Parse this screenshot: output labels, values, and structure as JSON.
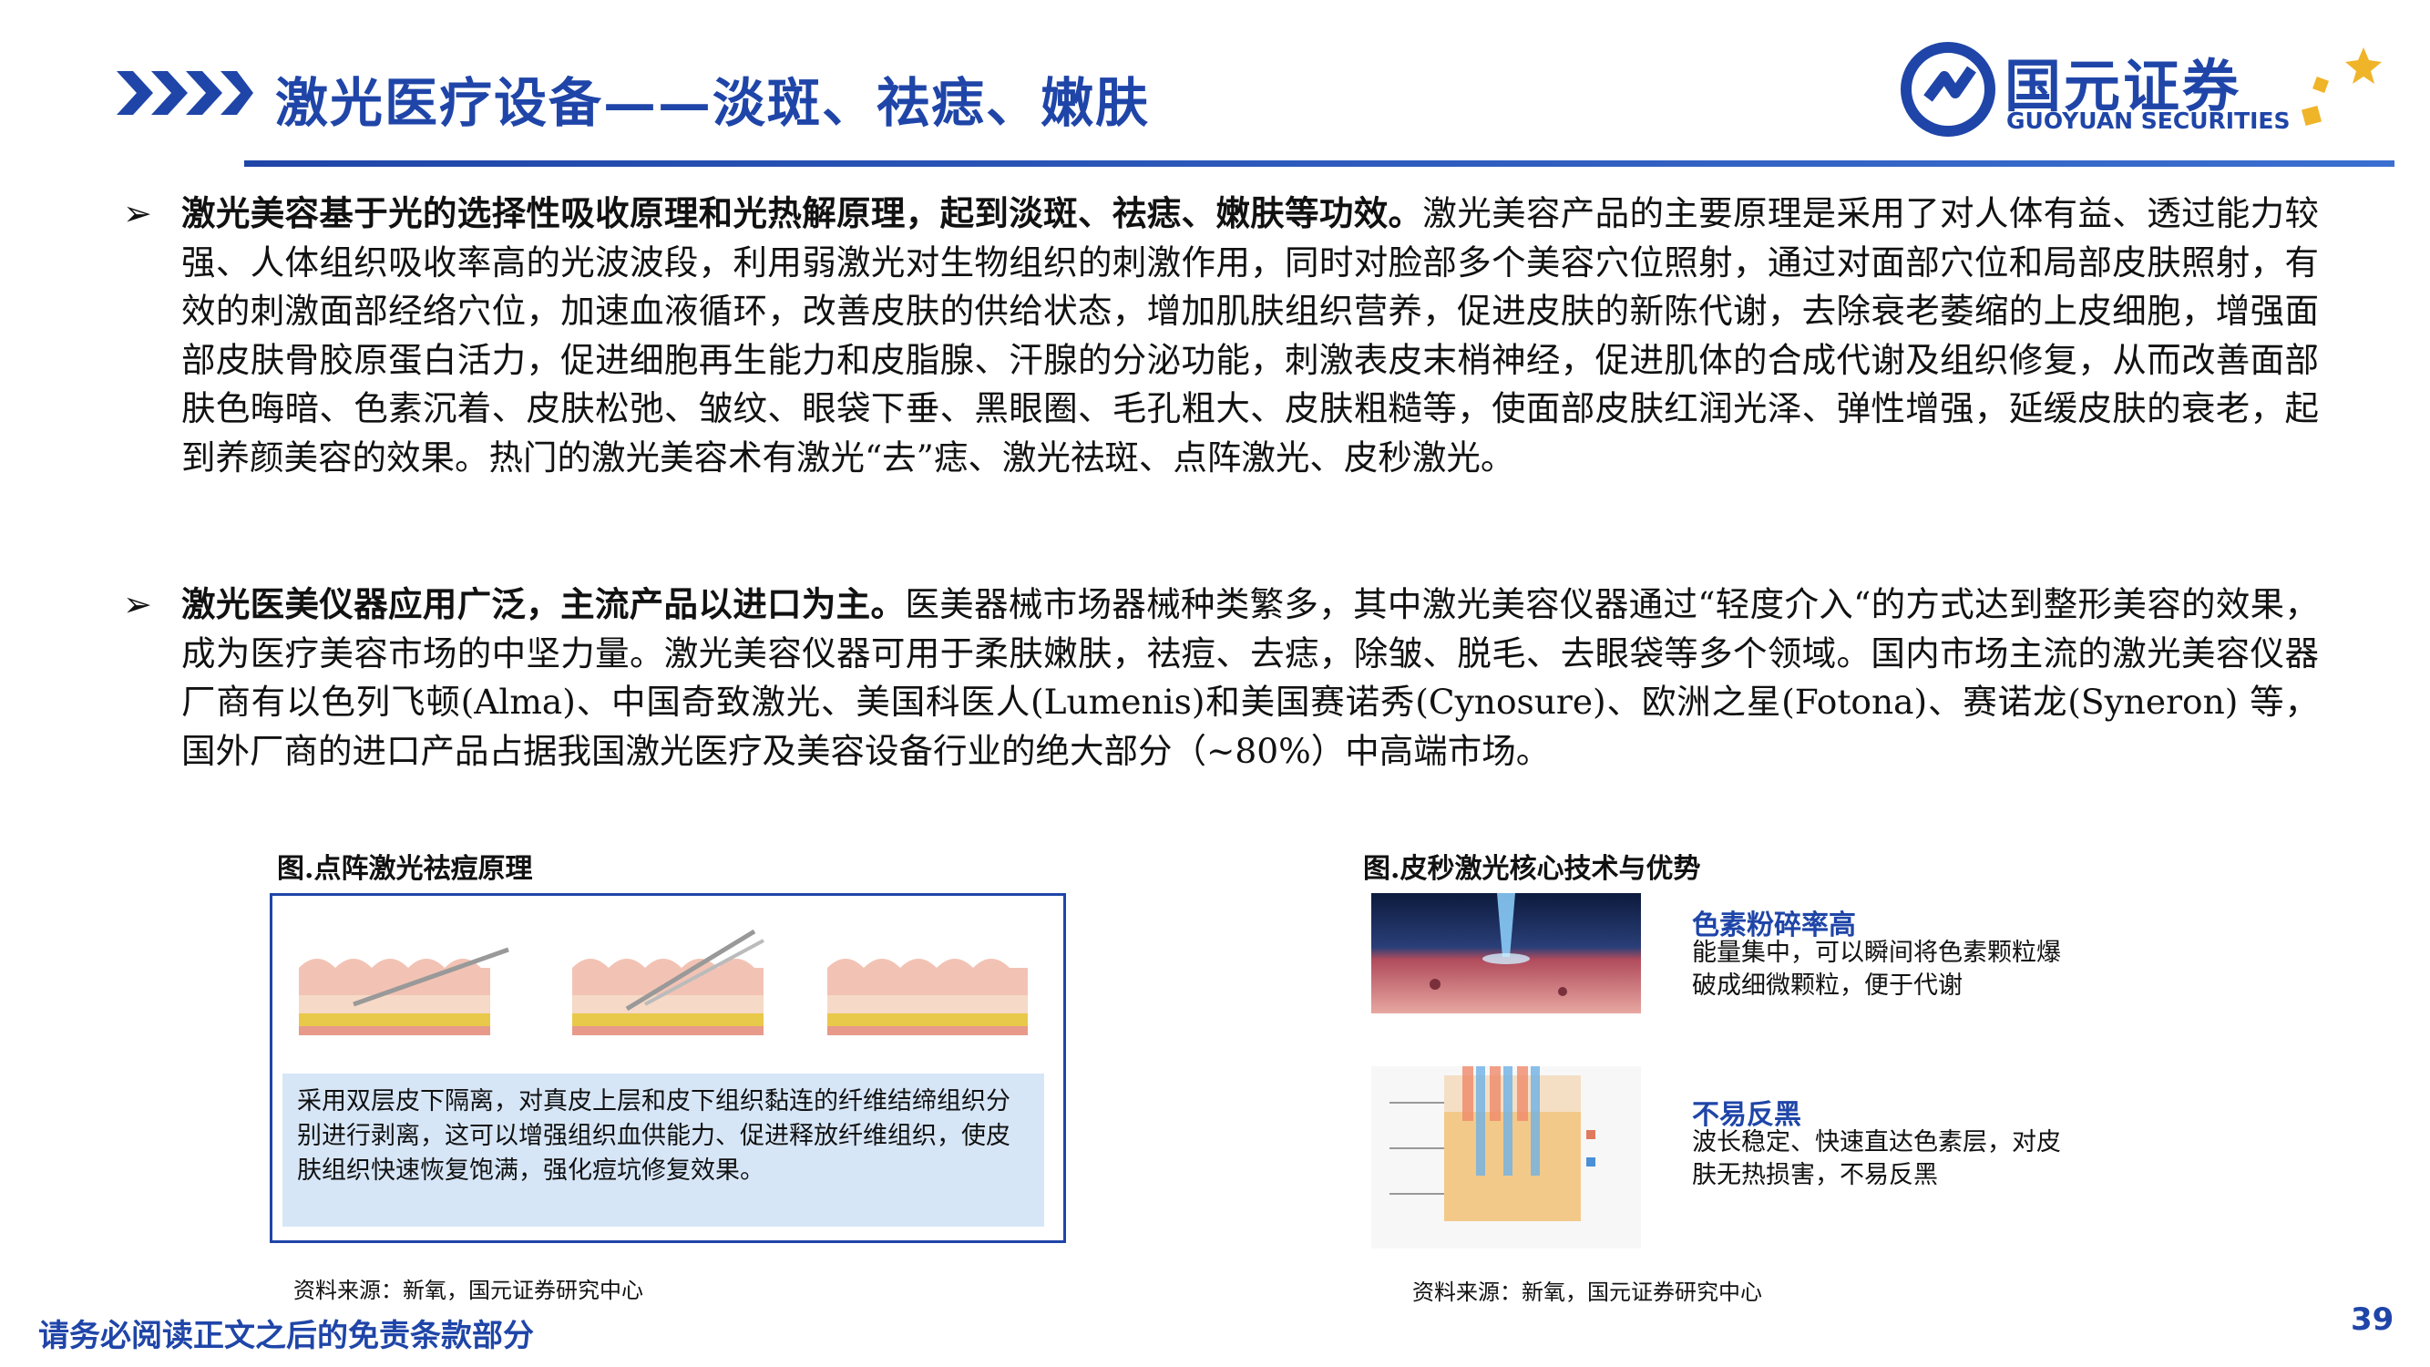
{
  "header": {
    "title": "激光医疗设备——淡斑、祛痣、嫩肤",
    "logo_cn": "国元证券",
    "logo_en": "GUOYUAN SECURITIES"
  },
  "bullets": [
    {
      "marker": "➢",
      "bold": "激光美容基于光的选择性吸收原理和光热解原理，起到淡斑、祛痣、嫩肤等功效。",
      "text": "激光美容产品的主要原理是采用了对人体有益、透过能力较强、人体组织吸收率高的光波波段，利用弱激光对生物组织的刺激作用，同时对脸部多个美容穴位照射，通过对面部穴位和局部皮肤照射，有效的刺激面部经络穴位，加速血液循环，改善皮肤的供给状态，增加肌肤组织营养，促进皮肤的新陈代谢，去除衰老萎缩的上皮细胞，增强面部皮肤骨胶原蛋白活力，促进细胞再生能力和皮脂腺、汗腺的分泌功能，刺激表皮末梢神经，促进肌体的合成代谢及组织修复，从而改善面部肤色晦暗、色素沉着、皮肤松弛、皱纹、眼袋下垂、黑眼圈、毛孔粗大、皮肤粗糙等，使面部皮肤红润光泽、弹性增强，延缓皮肤的衰老，起到养颜美容的效果。热门的激光美容术有激光“去”痣、激光祛斑、点阵激光、皮秒激光。"
    },
    {
      "marker": "➢",
      "bold": "激光医美仪器应用广泛，主流产品以进口为主。",
      "text": "医美器械市场器械种类繁多，其中激光美容仪器通过“轻度介入“的方式达到整形美容的效果，成为医疗美容市场的中坚力量。激光美容仪器可用于柔肤嫩肤，祛痘、去痣，除皱、脱毛、去眼袋等多个领域。国内市场主流的激光美容仪器厂商有以色列飞顿(Alma)、中国奇致激光、美国科医人(Lumenis)和美国赛诺秀(Cynosure)、欧洲之星(Fotona)、赛诺龙(Syneron) 等，国外厂商的进口产品占据我国激光医疗及美容设备行业的绝大部分（~80%）中高端市场。"
    }
  ],
  "figure_left": {
    "caption": "图.点阵激光祛痘原理",
    "note": "采用双层皮下隔离，对真皮上层和皮下组织黏连的纤维结缔组织分别进行剥离，这可以增强组织血供能力、促进释放纤维组织，使皮肤组织快速恢复饱满，强化痘坑修复效果。",
    "source": "资料来源：新氧，国元证券研究中心"
  },
  "figure_right": {
    "caption": "图.皮秒激光核心技术与优势",
    "features": [
      {
        "title": "色素粉碎率高",
        "desc": "能量集中，可以瞬间将色素颗粒爆破成细微颗粒，便于代谢"
      },
      {
        "title": "不易反黑",
        "desc": "波长稳定、快速直达色素层，对皮肤无热损害，不易反黑"
      }
    ],
    "source": "资料来源：新氧，国元证券研究中心"
  },
  "footer": {
    "disclaimer": "请务必阅读正文之后的免责条款部分",
    "page_number": "39"
  }
}
